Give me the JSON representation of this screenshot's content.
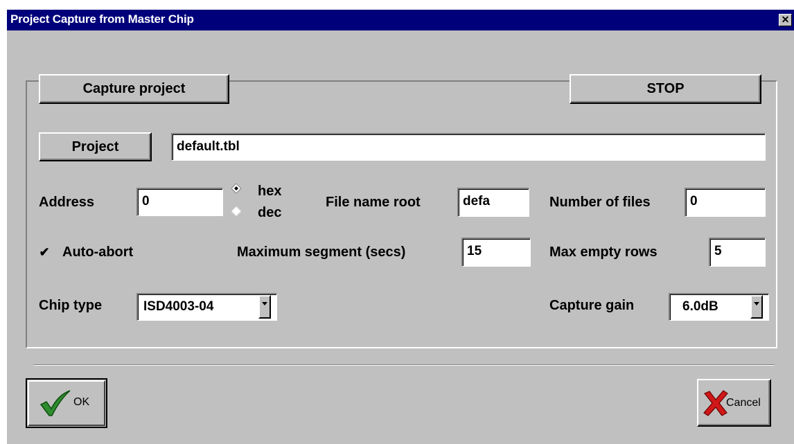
{
  "window": {
    "title": "Project Capture from Master Chip",
    "close_glyph": "✕"
  },
  "buttons": {
    "capture_project": "Capture project",
    "stop": "STOP",
    "project": "Project",
    "ok": "OK",
    "cancel": "Cancel"
  },
  "project_file": {
    "value": "default.tbl"
  },
  "address": {
    "label": "Address",
    "value": "0",
    "radix_options": [
      {
        "label": "hex",
        "selected": true
      },
      {
        "label": "dec",
        "selected": false
      }
    ]
  },
  "file_name_root": {
    "label": "File name root",
    "value": "defa"
  },
  "number_of_files": {
    "label": "Number of files",
    "value": "0"
  },
  "auto_abort": {
    "label": "Auto-abort",
    "checked": true
  },
  "maximum_segment": {
    "label": "Maximum segment (secs)",
    "value": "15"
  },
  "max_empty_rows": {
    "label": "Max empty rows",
    "value": "5"
  },
  "chip_type": {
    "label": "Chip type",
    "selected": "ISD4003-04"
  },
  "capture_gain": {
    "label": "Capture gain",
    "selected": "6.0dB"
  },
  "icons": {
    "ok_icon": "green-check-icon",
    "cancel_icon": "red-x-icon"
  },
  "colors": {
    "titlebar": "#00007b",
    "face": "#c0c0c0",
    "check_green": "#2e8b2e",
    "cancel_red": "#d01818"
  }
}
